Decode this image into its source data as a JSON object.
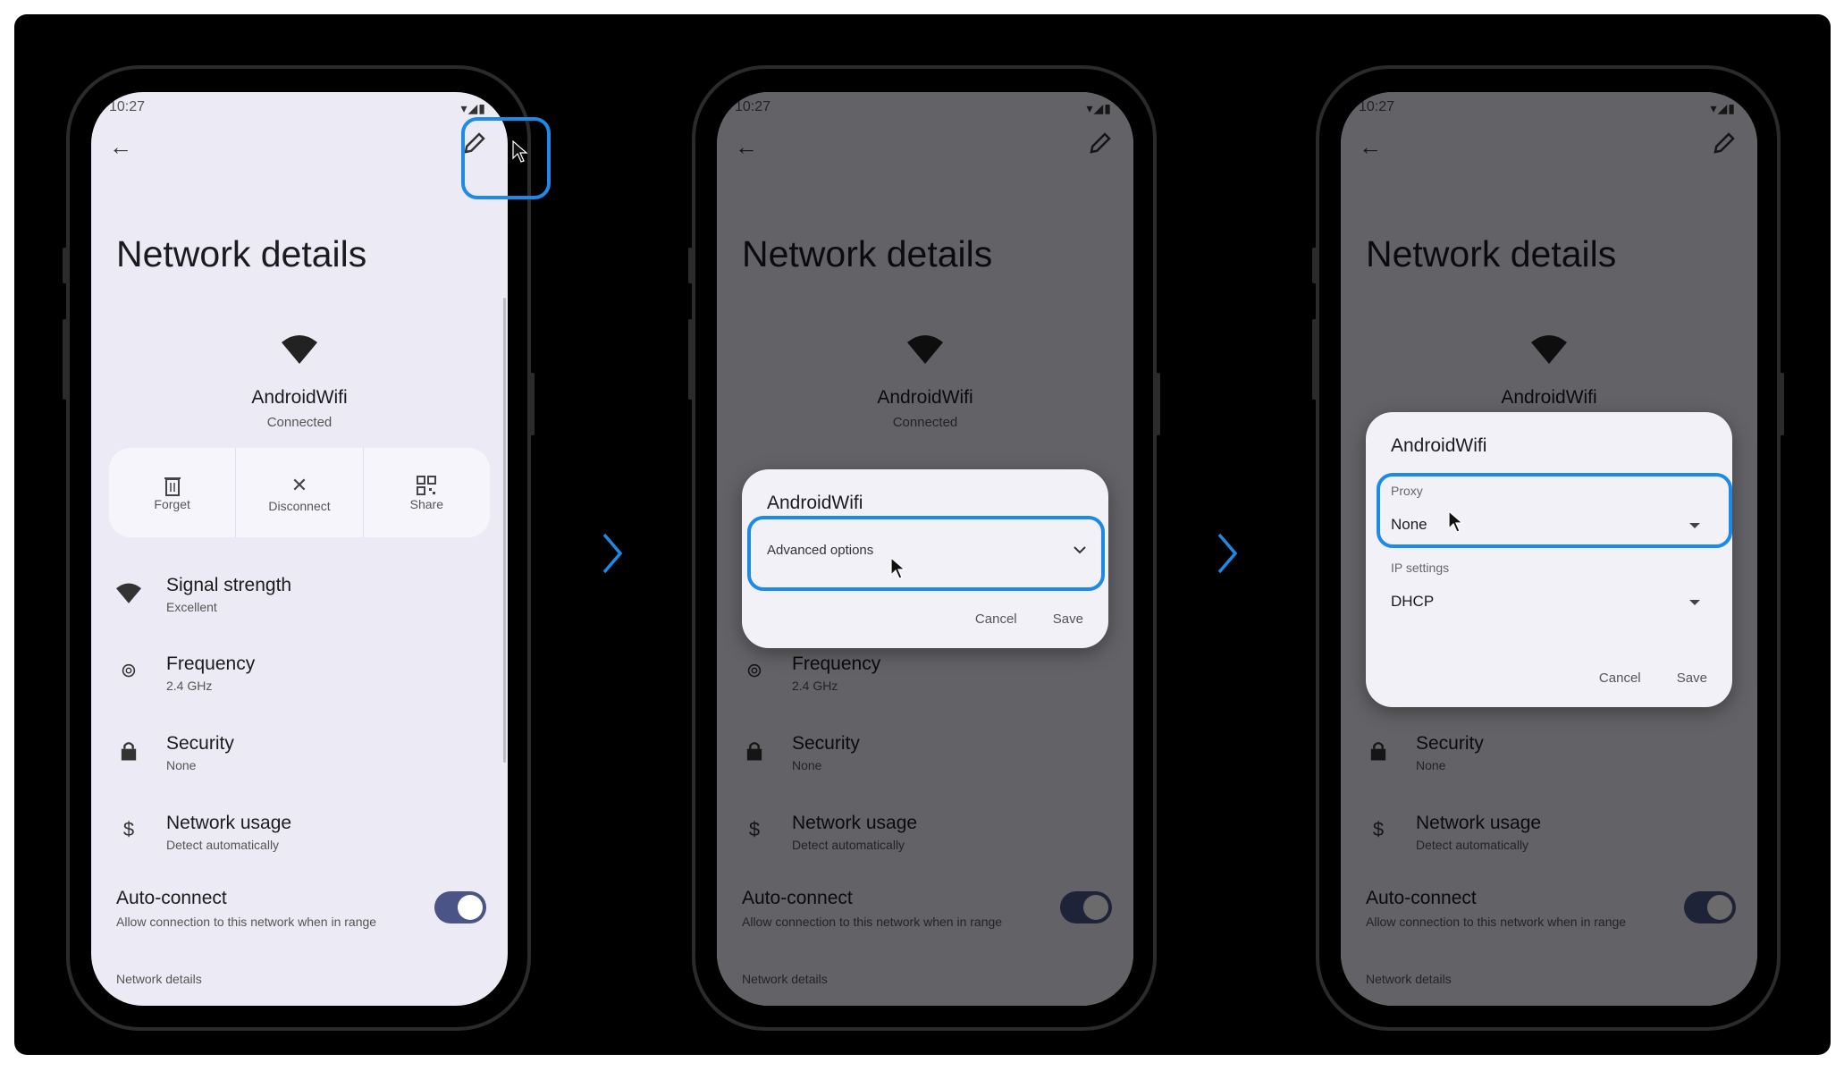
{
  "colors": {
    "highlight": "#1E8AE8",
    "toggle_on": "#4A5487",
    "screen_bg": "#ECEAF4"
  },
  "icons": [
    "back-arrow-icon",
    "edit-pencil-icon",
    "wifi-icon",
    "trash-icon",
    "close-icon",
    "qr-code-icon",
    "frequency-icon",
    "lock-icon",
    "dollar-icon",
    "chevron-right-icon",
    "chevron-down-icon",
    "dropdown-caret-icon",
    "cursor-icon"
  ],
  "status": {
    "time": "10:27",
    "icons": "▾◢▮"
  },
  "page": {
    "title": "Network details",
    "network_name": "AndroidWifi",
    "network_status": "Connected",
    "actions": {
      "forget": "Forget",
      "disconnect": "Disconnect",
      "share": "Share"
    },
    "rows": {
      "signal": {
        "title": "Signal strength",
        "value": "Excellent"
      },
      "frequency": {
        "title": "Frequency",
        "value": "2.4 GHz"
      },
      "security": {
        "title": "Security",
        "value": "None"
      },
      "usage": {
        "title": "Network usage",
        "value": "Detect automatically"
      }
    },
    "auto_connect": {
      "title": "Auto-connect",
      "subtitle": "Allow connection to this network when in range",
      "enabled": true
    },
    "section_header": "Network details"
  },
  "dialog1": {
    "title": "AndroidWifi",
    "advanced": "Advanced options",
    "cancel": "Cancel",
    "save": "Save"
  },
  "dialog2": {
    "title": "AndroidWifi",
    "proxy_label": "Proxy",
    "proxy_value": "None",
    "ip_label": "IP settings",
    "ip_value": "DHCP",
    "cancel": "Cancel",
    "save": "Save"
  }
}
